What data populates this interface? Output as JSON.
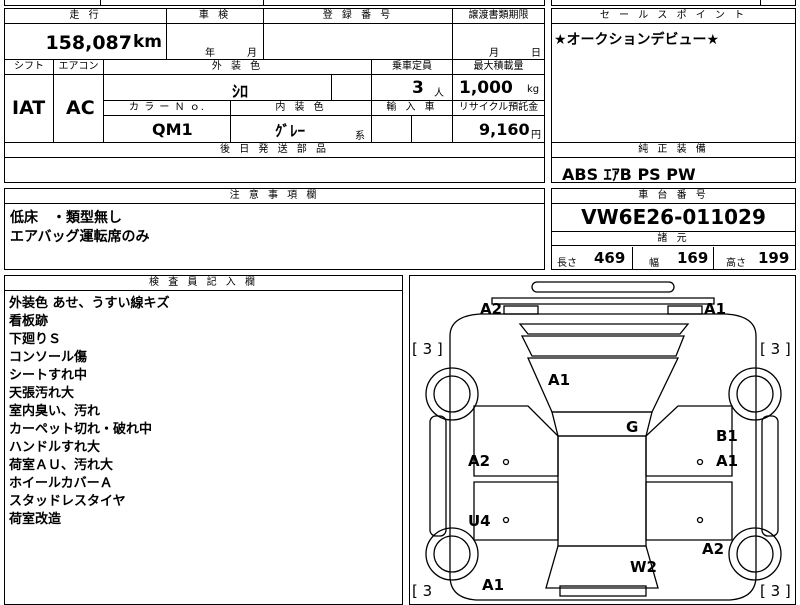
{
  "top": {
    "mileage_header": "走 行",
    "mileage_value": "158,087",
    "mileage_unit": "km",
    "inspection_header": "車 検",
    "inspection_year": "年",
    "inspection_month": "月",
    "registration_header": "登 録 番 号",
    "transfer_header": "譲渡書類期限",
    "transfer_month": "月",
    "transfer_day": "日",
    "shift_header": "シフト",
    "shift_value": "IAT",
    "ac_header": "エアコン",
    "ac_value": "AC",
    "exterior_header": "外 装 色",
    "exterior_value": "ｼﾛ",
    "capacity_header": "乗車定員",
    "capacity_value": "3",
    "capacity_unit": "人",
    "load_header": "最大積載量",
    "load_value": "1,000",
    "load_unit": "kg",
    "color_no_header": "カ ラ ー Ｎ ｏ.",
    "color_no_value": "QM1",
    "interior_header": "内 装 色",
    "interior_value": "ｸﾞﾚｰ",
    "interior_suffix": "系",
    "import_header": "輸 入 車",
    "recycle_header": "リサイクル預託金",
    "recycle_value": "9,160",
    "recycle_unit": "円",
    "later_parts_header": "後 日 発 送 部 品"
  },
  "sales": {
    "header": "セ ー ル ス ポ イ ン ト",
    "text": "★オークションデビュー★"
  },
  "genuine": {
    "header": "純 正 装 備",
    "text": "ABS ｴｱB PS PW"
  },
  "caution": {
    "header": "注 意 事 項 欄",
    "lines": [
      "低床　・類型無し",
      "エアバッグ運転席のみ"
    ]
  },
  "chassis": {
    "header": "車 台 番 号",
    "value": "VW6E26-011029",
    "spec_header": "諸 元",
    "length_label": "長さ",
    "length_value": "469",
    "width_label": "幅",
    "width_value": "169",
    "height_label": "高さ",
    "height_value": "199"
  },
  "inspector": {
    "header": "検 査 員 記 入 欄",
    "lines": [
      "外装色 あせ、うすい線キズ",
      "看板跡",
      "下廻りＳ",
      "コンソール傷",
      "シートすれ中",
      "天張汚れ大",
      "室内臭い、汚れ",
      "カーペット切れ・破れ中",
      "ハンドルすれ大",
      "荷室ＡＵ、汚れ大",
      "ホイールカバーＡ",
      "スタッドレスタイヤ",
      "荷室改造"
    ]
  },
  "diagram": {
    "tire_tl": "[ 3 ]",
    "tire_tr": "[ 3 ]",
    "tire_bl": "[ 3",
    "tire_br": "[ 3 ]",
    "marks": {
      "front_left": "A2",
      "front_right": "A1",
      "hood": "A1",
      "roof": "G",
      "right_front_door_1": "B1",
      "right_front_door_2": "A1",
      "left_front_door": "A2",
      "left_rear_door": "U4",
      "right_rear": "A2",
      "rear_center": "W2",
      "rear_left": "A1"
    }
  }
}
